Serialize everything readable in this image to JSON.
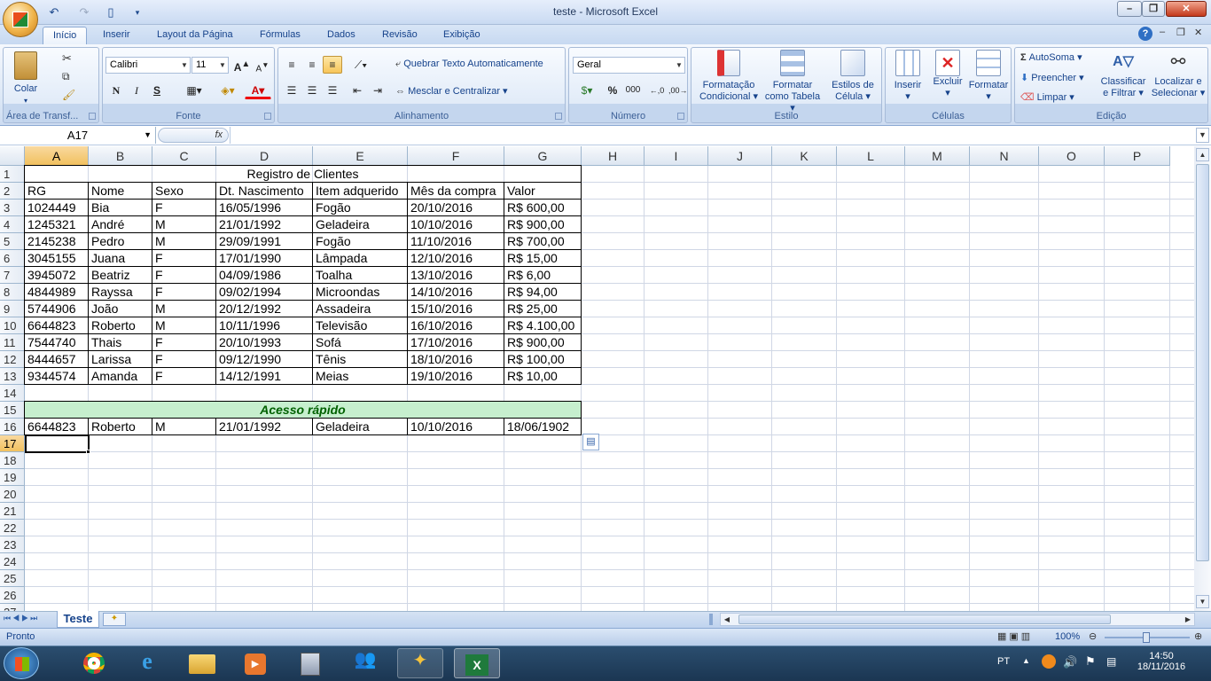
{
  "window": {
    "title": "teste - Microsoft Excel"
  },
  "quick_access": {
    "save_icon": "save-icon",
    "undo_icon": "undo-icon",
    "redo_icon": "redo-icon",
    "new_icon": "new-document-icon"
  },
  "tabs": [
    "Início",
    "Inserir",
    "Layout da Página",
    "Fórmulas",
    "Dados",
    "Revisão",
    "Exibição"
  ],
  "active_tab": "Início",
  "ribbon": {
    "clipboard": {
      "label": "Área de Transf...",
      "paste": "Colar"
    },
    "font": {
      "label": "Fonte",
      "name": "Calibri",
      "size": "11",
      "bold": "N",
      "italic": "I",
      "underline": "S",
      "grow": "A",
      "shrink": "A"
    },
    "alignment": {
      "label": "Alinhamento",
      "wrap": "Quebrar Texto Automaticamente",
      "merge": "Mesclar e Centralizar"
    },
    "number": {
      "label": "Número",
      "format": "Geral",
      "percent": "%",
      "thousands": "000"
    },
    "styles": {
      "label": "Estilo",
      "cond_format": [
        "Formatação",
        "Condicional"
      ],
      "table_format": [
        "Formatar",
        "como Tabela"
      ],
      "cell_styles": [
        "Estilos de",
        "Célula"
      ]
    },
    "cells": {
      "label": "Células",
      "insert": "Inserir",
      "delete": "Excluir",
      "format": "Formatar"
    },
    "editing": {
      "label": "Edição",
      "autosum": "AutoSoma",
      "fill": "Preencher",
      "clear": "Limpar",
      "sort": [
        "Classificar",
        "e Filtrar"
      ],
      "find": [
        "Localizar e",
        "Selecionar"
      ]
    }
  },
  "formula_bar": {
    "name_box": "A17",
    "fx": "fx",
    "value": ""
  },
  "columns": [
    "A",
    "B",
    "C",
    "D",
    "E",
    "F",
    "G",
    "H",
    "I",
    "J",
    "K",
    "L",
    "M",
    "N",
    "O",
    "P"
  ],
  "rows": [
    "1",
    "2",
    "3",
    "4",
    "5",
    "6",
    "7",
    "8",
    "9",
    "10",
    "11",
    "12",
    "13",
    "14",
    "15",
    "16",
    "17",
    "18",
    "19",
    "20",
    "21",
    "22",
    "23",
    "24",
    "25",
    "26",
    "27"
  ],
  "sheet": {
    "title": "Registro de Clientes",
    "headers": [
      "RG",
      "Nome",
      "Sexo",
      "Dt. Nascimento",
      "Item adquerido",
      "Mês da compra",
      "Valor"
    ],
    "records": [
      [
        "1024449",
        "Bia",
        "F",
        "16/05/1996",
        "Fogão",
        "20/10/2016",
        "R$ 600,00"
      ],
      [
        "1245321",
        "André",
        "M",
        "21/01/1992",
        "Geladeira",
        "10/10/2016",
        "R$ 900,00"
      ],
      [
        "2145238",
        "Pedro",
        "M",
        "29/09/1991",
        "Fogão",
        "11/10/2016",
        "R$ 700,00"
      ],
      [
        "3045155",
        "Juana",
        "F",
        "17/01/1990",
        "Lâmpada",
        "12/10/2016",
        "R$ 15,00"
      ],
      [
        "3945072",
        "Beatriz",
        "F",
        "04/09/1986",
        "Toalha",
        "13/10/2016",
        "R$ 6,00"
      ],
      [
        "4844989",
        "Rayssa",
        "F",
        "09/02/1994",
        "Microondas",
        "14/10/2016",
        "R$ 94,00"
      ],
      [
        "5744906",
        "João",
        "M",
        "20/12/1992",
        "Assadeira",
        "15/10/2016",
        "R$ 25,00"
      ],
      [
        "6644823",
        "Roberto",
        "M",
        "10/11/1996",
        "Televisão",
        "16/10/2016",
        "R$ 4.100,00"
      ],
      [
        "7544740",
        "Thais",
        "F",
        "20/10/1993",
        "Sofá",
        "17/10/2016",
        "R$ 900,00"
      ],
      [
        "8444657",
        "Larissa",
        "F",
        "09/12/1990",
        "Tênis",
        "18/10/2016",
        "R$ 100,00"
      ],
      [
        "9344574",
        "Amanda",
        "F",
        "14/12/1991",
        "Meias",
        "19/10/2016",
        "R$ 10,00"
      ]
    ],
    "quick_access_title": "Acesso rápido",
    "quick_access_row": [
      "6644823",
      "Roberto",
      "M",
      "21/01/1992",
      "Geladeira",
      "10/10/2016",
      "18/06/1902"
    ]
  },
  "sheet_tabs": [
    "Teste"
  ],
  "status": {
    "text": "Pronto",
    "zoom": "100%"
  },
  "taskbar": {
    "lang": "PT",
    "time": "14:50",
    "date": "18/11/2016"
  },
  "colors": {
    "selected_header": "#f1c15f",
    "quick_access_fill": "#c6efce",
    "quick_access_text": "#006100"
  }
}
